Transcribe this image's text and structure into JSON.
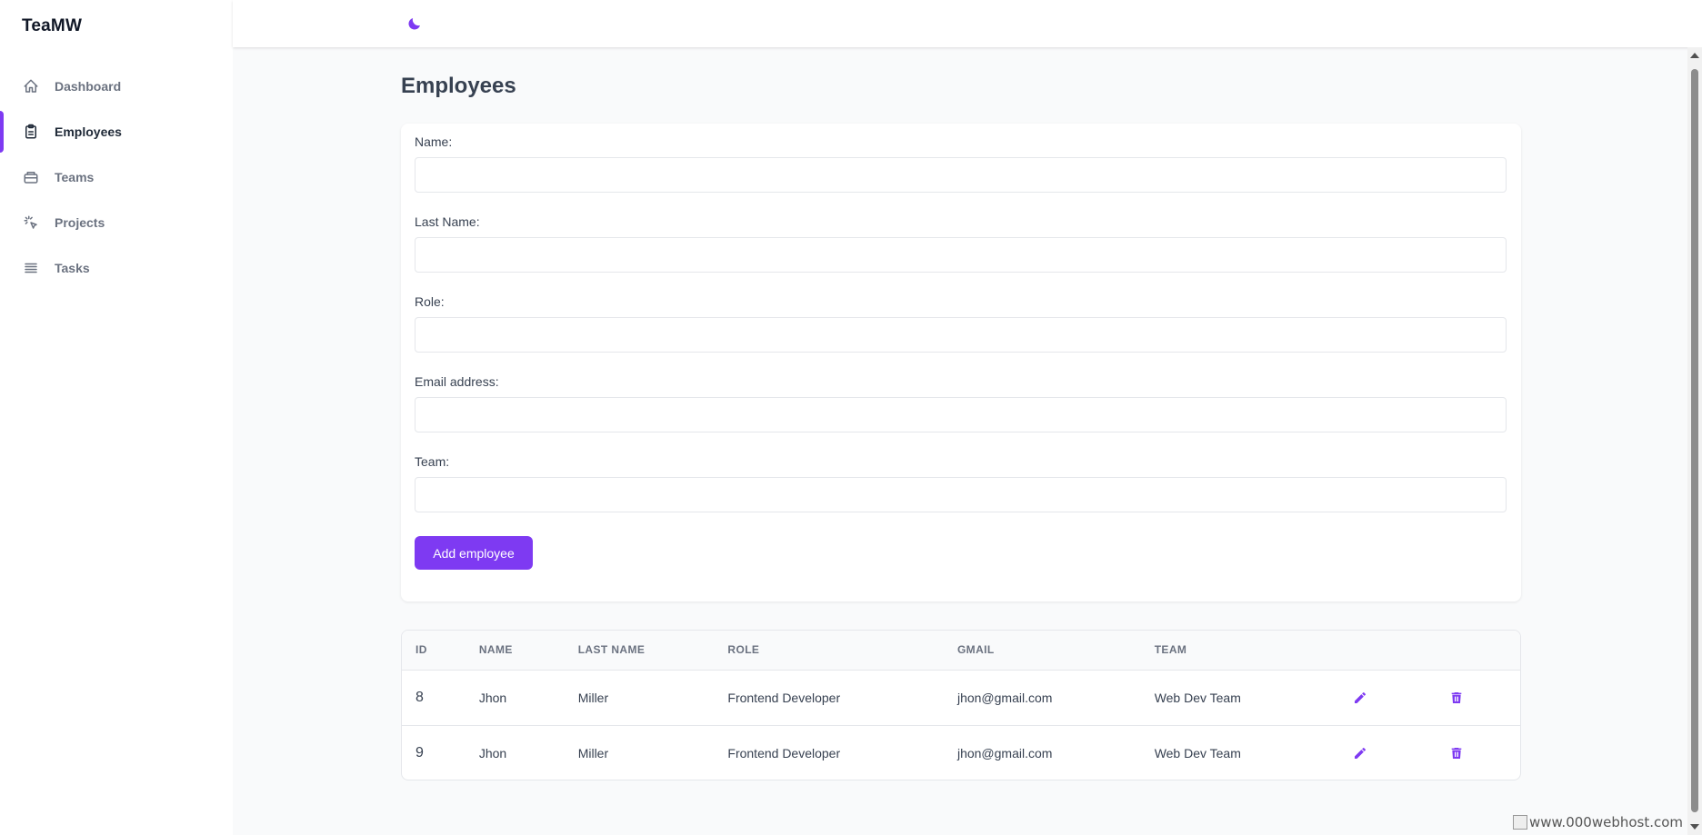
{
  "app": {
    "brand": "TeaMW"
  },
  "colors": {
    "accent": "#7e3af2",
    "text_muted": "#6b7280"
  },
  "sidebar": {
    "items": [
      {
        "label": "Dashboard",
        "icon": "home-icon",
        "active": false
      },
      {
        "label": "Employees",
        "icon": "clipboard-icon",
        "active": true
      },
      {
        "label": "Teams",
        "icon": "briefcase-icon",
        "active": false
      },
      {
        "label": "Projects",
        "icon": "cursor-click-icon",
        "active": false
      },
      {
        "label": "Tasks",
        "icon": "list-icon",
        "active": false
      }
    ]
  },
  "topbar": {
    "theme_toggle_icon": "moon-icon"
  },
  "page": {
    "title": "Employees"
  },
  "form": {
    "name_label": "Name:",
    "name_value": "",
    "last_name_label": "Last Name:",
    "last_name_value": "",
    "role_label": "Role:",
    "role_value": "",
    "email_label": "Email address:",
    "email_value": "",
    "team_label": "Team:",
    "team_value": "",
    "submit_label": "Add employee"
  },
  "table": {
    "headers": [
      "ID",
      "NAME",
      "LAST NAME",
      "ROLE",
      "GMAIL",
      "TEAM"
    ],
    "rows": [
      {
        "id": "8",
        "name": "Jhon",
        "last_name": "Miller",
        "role": "Frontend Developer",
        "gmail": "jhon@gmail.com",
        "team": "Web Dev Team"
      },
      {
        "id": "9",
        "name": "Jhon",
        "last_name": "Miller",
        "role": "Frontend Developer",
        "gmail": "jhon@gmail.com",
        "team": "Web Dev Team"
      }
    ]
  },
  "footer": {
    "host_badge": "www.000webhost.com"
  }
}
